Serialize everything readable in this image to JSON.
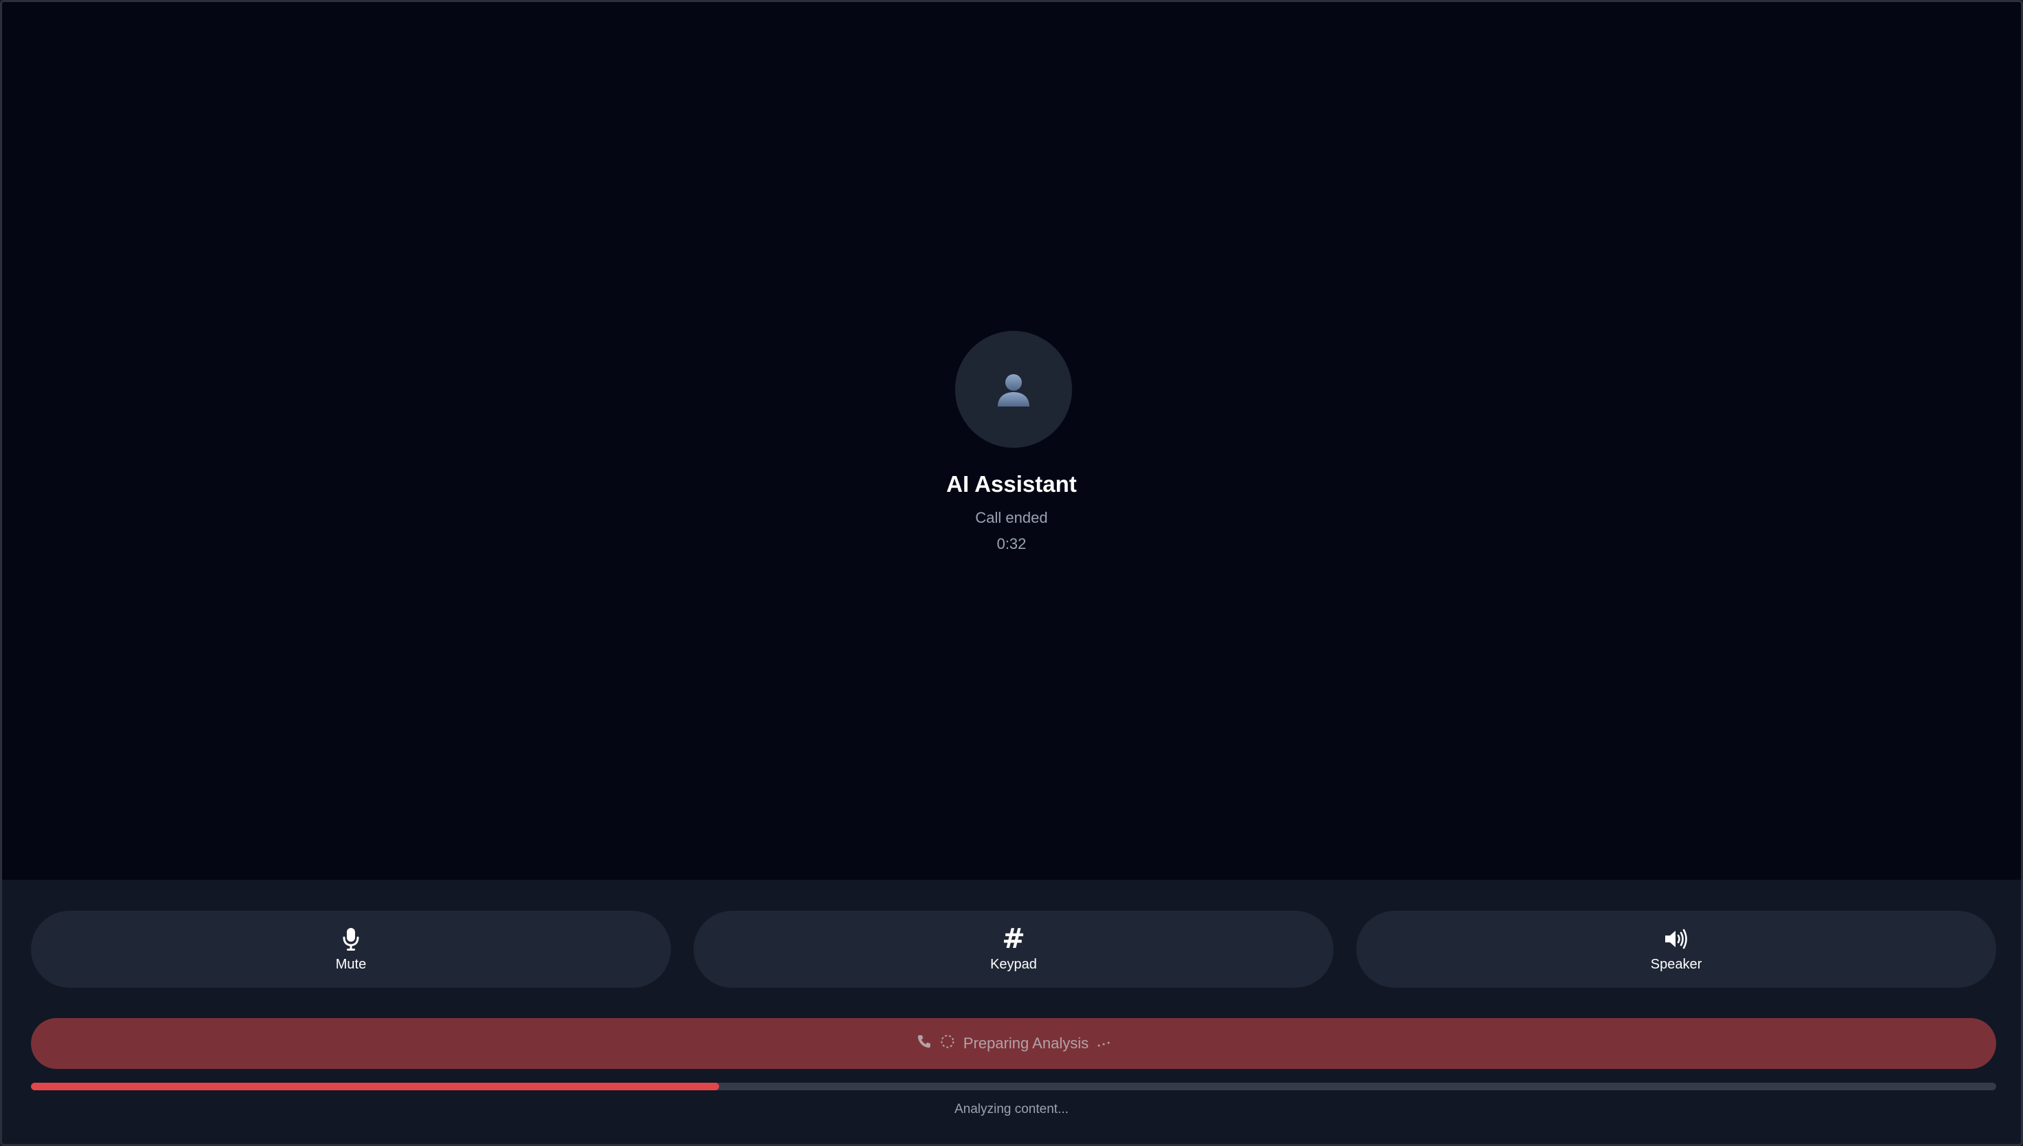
{
  "contact": {
    "name": "AI Assistant",
    "status": "Call ended",
    "duration": "0:32",
    "avatar_icon": "person-icon"
  },
  "controls": [
    {
      "label": "Mute",
      "icon": "microphone-icon"
    },
    {
      "label": "Keypad",
      "icon": "hash-icon",
      "glyph": "#"
    },
    {
      "label": "Speaker",
      "icon": "speaker-icon"
    }
  ],
  "end_call": {
    "label": "Preparing Analysis",
    "icons": [
      "phone-icon",
      "spinner-icon",
      "dots-icon"
    ]
  },
  "progress": {
    "value": 0.35,
    "text": "Analyzing content..."
  },
  "colors": {
    "background": "#040713",
    "panel": "#111725",
    "button": "#1f2635",
    "end_call": "#7a3238",
    "progress_fill": "#e1474a",
    "progress_track": "#353b48"
  }
}
